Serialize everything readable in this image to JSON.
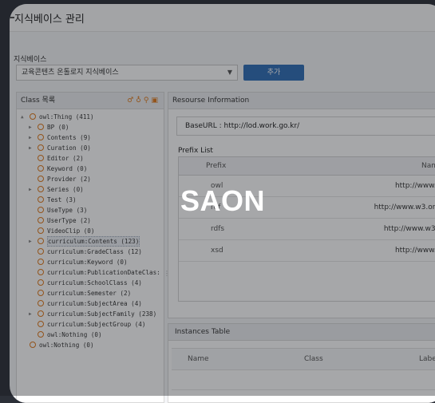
{
  "window": {
    "title": "지식베이스 관리"
  },
  "kb": {
    "label": "지식베이스",
    "selected": "교육콘텐츠 온톨로지 지식베이스",
    "add_label": "추가"
  },
  "class_panel": {
    "title": "Class 목록",
    "tree": [
      {
        "label": "owl:Thing (411)",
        "level": 0,
        "arrow": "▲"
      },
      {
        "label": "BP (0)",
        "level": 1,
        "arrow": "▶"
      },
      {
        "label": "Contents (9)",
        "level": 1,
        "arrow": "▶"
      },
      {
        "label": "Curation (0)",
        "level": 1,
        "arrow": "▶"
      },
      {
        "label": "Editor (2)",
        "level": 1,
        "arrow": ""
      },
      {
        "label": "Keyword (0)",
        "level": 1,
        "arrow": ""
      },
      {
        "label": "Provider (2)",
        "level": 1,
        "arrow": ""
      },
      {
        "label": "Series (0)",
        "level": 1,
        "arrow": "▶"
      },
      {
        "label": "Test (3)",
        "level": 1,
        "arrow": ""
      },
      {
        "label": "UseType (3)",
        "level": 1,
        "arrow": ""
      },
      {
        "label": "UserType (2)",
        "level": 1,
        "arrow": ""
      },
      {
        "label": "VideoClip (0)",
        "level": 1,
        "arrow": ""
      },
      {
        "label": "curriculum:Contents (123)",
        "level": 1,
        "arrow": "▶",
        "highlight": true
      },
      {
        "label": "curriculum:GradeClass (12)",
        "level": 1,
        "arrow": ""
      },
      {
        "label": "curriculum:Keyword (0)",
        "level": 1,
        "arrow": ""
      },
      {
        "label": "curriculum:PublicationDateClas:",
        "level": 1,
        "arrow": ""
      },
      {
        "label": "curriculum:SchoolClass (4)",
        "level": 1,
        "arrow": ""
      },
      {
        "label": "curriculum:Semester (2)",
        "level": 1,
        "arrow": ""
      },
      {
        "label": "curriculum:SubjectArea (4)",
        "level": 1,
        "arrow": ""
      },
      {
        "label": "curriculum:SubjectFamily (238)",
        "level": 1,
        "arrow": "▶"
      },
      {
        "label": "curriculum:SubjectGroup (4)",
        "level": 1,
        "arrow": ""
      },
      {
        "label": "owl:Nothing (0)",
        "level": 1,
        "arrow": ""
      },
      {
        "label": "owl:Nothing (0)",
        "level": 0,
        "arrow": ""
      }
    ]
  },
  "resource_panel": {
    "title": "Resourse Information",
    "base_url": "BaseURL : http://lod.work.go.kr/",
    "prefix_label": "Prefix List",
    "col_prefix": "Prefix",
    "col_namespace": "Nam",
    "rows": [
      {
        "prefix": "owl",
        "ns": "http://www.w"
      },
      {
        "prefix": "rdf",
        "ns": "http://www.w3.org/"
      },
      {
        "prefix": "rdfs",
        "ns": "http://www.w3.o"
      },
      {
        "prefix": "xsd",
        "ns": "http://www.w"
      }
    ]
  },
  "instances_panel": {
    "title": "Instances Table",
    "col_name": "Name",
    "col_class": "Class",
    "col_label": "Labe"
  },
  "overlay": {
    "brand": "SAON"
  },
  "colors": {
    "accent": "#2f6fb7",
    "tree_icon": "#e07a1b"
  }
}
